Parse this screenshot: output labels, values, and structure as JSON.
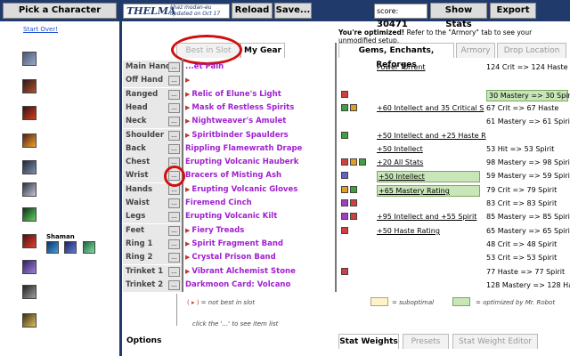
{
  "toolbar": {
    "pick_character": "Pick a Character",
    "char_name": "THELMA",
    "char_realm": "khaz modan-eu",
    "char_updated": "updated on Oct 17",
    "reload": "Reload",
    "save": "Save...",
    "score_label": "score:",
    "score_value": "30471",
    "show_stats": "Show Stats",
    "export": "Export"
  },
  "left": {
    "start_over": "Start Over!",
    "class_label": "Shaman"
  },
  "main": {
    "optimized_bold": "You're optimized!",
    "optimized_rest": " Refer to the \"Armory\" tab to see your unmodified setup.",
    "tabs_left": [
      "Best in Slot",
      "My Gear"
    ],
    "tabs_right": [
      "Gems, Enchants, Reforges",
      "Armory",
      "Drop Location"
    ],
    "rows": [
      {
        "slot": "Main Hand",
        "item": "...et Pain",
        "mark": false,
        "enchant": "Power Torrent",
        "enchant_hl": false,
        "reforge": "124 Crit => 124 Haste",
        "reforge_hl": false
      },
      {
        "slot": "Off Hand",
        "item": "",
        "mark": true,
        "enchant": "",
        "enchant_hl": false,
        "reforge": "",
        "reforge_hl": false
      },
      {
        "slot": "Ranged",
        "item": "Relic of Elune's Light",
        "mark": true,
        "enchant": "",
        "enchant_hl": false,
        "reforge": "30 Mastery => 30 Spirit",
        "reforge_hl": true
      },
      {
        "slot": "Head",
        "item": "Mask of Restless Spirits",
        "mark": true,
        "enchant": "+60 Intellect and 35 Critical S",
        "enchant_hl": false,
        "reforge": "67 Crit => 67 Haste",
        "reforge_hl": false
      },
      {
        "slot": "Neck",
        "item": "Nightweaver's Amulet",
        "mark": true,
        "enchant": "",
        "enchant_hl": false,
        "reforge": "61 Mastery => 61 Spirit",
        "reforge_hl": false
      },
      {
        "slot": "Shoulder",
        "item": "Spiritbinder Spaulders",
        "mark": true,
        "enchant": "+50 Intellect and +25 Haste R",
        "enchant_hl": false,
        "reforge": "",
        "reforge_hl": false
      },
      {
        "slot": "Back",
        "item": "Rippling Flamewrath Drape",
        "mark": false,
        "enchant": "+50 Intellect",
        "enchant_hl": false,
        "reforge": "53 Hit => 53 Spirit",
        "reforge_hl": false
      },
      {
        "slot": "Chest",
        "item": "Erupting Volcanic Hauberk",
        "mark": false,
        "enchant": "+20 All Stats",
        "enchant_hl": false,
        "reforge": "98 Mastery => 98 Spirit",
        "reforge_hl": false
      },
      {
        "slot": "Wrist",
        "item": "Bracers of Misting Ash",
        "mark": false,
        "enchant": "+50 Intellect",
        "enchant_hl": true,
        "reforge": "59 Mastery => 59 Spirit",
        "reforge_hl": false
      },
      {
        "slot": "Hands",
        "item": "Erupting Volcanic Gloves",
        "mark": true,
        "enchant": "+65 Mastery Rating",
        "enchant_hl": true,
        "reforge": "79 Crit => 79 Spirit",
        "reforge_hl": false
      },
      {
        "slot": "Waist",
        "item": "Firemend Cinch",
        "mark": false,
        "enchant": "",
        "enchant_hl": false,
        "reforge": "83 Crit => 83 Spirit",
        "reforge_hl": false
      },
      {
        "slot": "Legs",
        "item": "Erupting Volcanic Kilt",
        "mark": false,
        "enchant": "+95 Intellect and +55 Spirit",
        "enchant_hl": false,
        "reforge": "85 Mastery => 85 Spirit",
        "reforge_hl": false
      },
      {
        "slot": "Feet",
        "item": "Fiery Treads",
        "mark": true,
        "enchant": "+50 Haste Rating",
        "enchant_hl": false,
        "reforge": "65 Mastery => 65 Spirit",
        "reforge_hl": false
      },
      {
        "slot": "Ring 1",
        "item": "Spirit Fragment Band",
        "mark": true,
        "enchant": "",
        "enchant_hl": false,
        "reforge": "48 Crit => 48 Spirit",
        "reforge_hl": false
      },
      {
        "slot": "Ring 2",
        "item": "Crystal Prison Band",
        "mark": true,
        "enchant": "",
        "enchant_hl": false,
        "reforge": "53 Crit => 53 Spirit",
        "reforge_hl": false
      },
      {
        "slot": "Trinket 1",
        "item": "Vibrant Alchemist Stone",
        "mark": true,
        "enchant": "",
        "enchant_hl": false,
        "reforge": "77 Haste => 77 Spirit",
        "reforge_hl": false
      },
      {
        "slot": "Trinket 2",
        "item": "Darkmoon Card: Volcano",
        "mark": false,
        "enchant": "",
        "enchant_hl": false,
        "reforge": "128 Mastery => 128 Haste",
        "reforge_hl": false
      }
    ],
    "legend": {
      "not_best": "= not best in slot",
      "click_hint": "click the '...' to see item list",
      "suboptimal": "= suboptimal",
      "optimized_by": "= optimized by Mr. Robot"
    },
    "bottom": {
      "options": "Options",
      "tabs": [
        "Stat Weights",
        "Presets",
        "Stat Weight Editor"
      ]
    }
  },
  "colors": {
    "accent": "#1f3a6b",
    "item_purple": "#a020d0",
    "highlight_green": "#c8e6b8",
    "circle_red": "#d01010"
  }
}
